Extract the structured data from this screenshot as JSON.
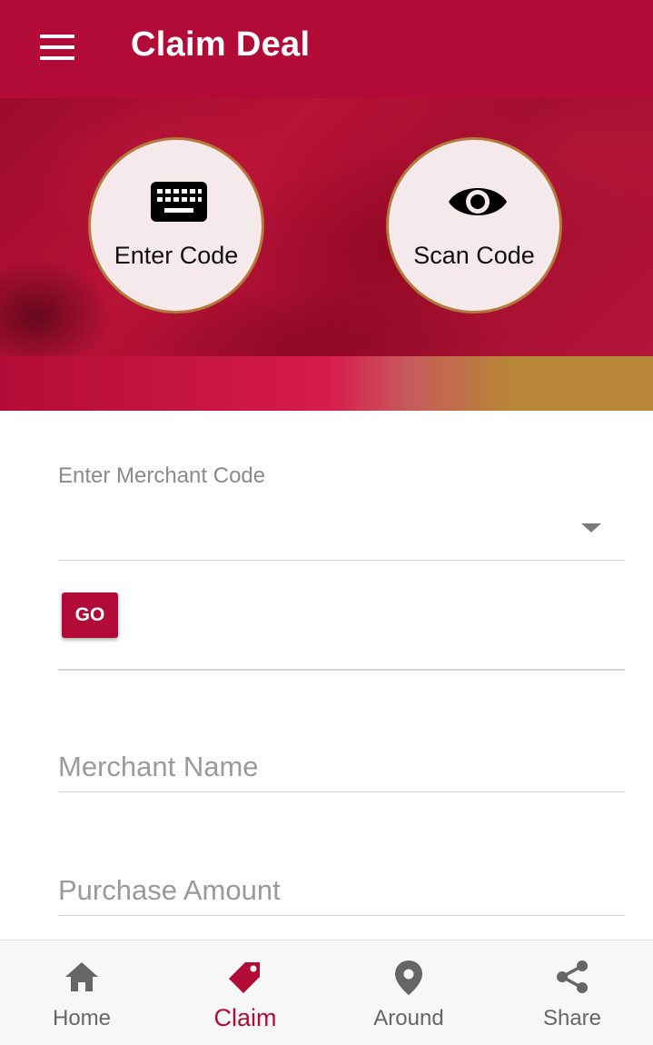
{
  "app_bar": {
    "title": "Claim Deal",
    "menu_icon": "menu-icon",
    "background_color": "#b30b37"
  },
  "hero": {
    "actions": [
      {
        "label": "Enter Code",
        "icon": "keyboard-icon"
      },
      {
        "label": "Scan Code",
        "icon": "eye-icon"
      }
    ]
  },
  "form": {
    "merchant_code_label": "Enter Merchant Code",
    "merchant_code_value": "",
    "go_label": "GO",
    "merchant_name_placeholder": "Merchant Name",
    "merchant_name_value": "",
    "purchase_amount_placeholder": "Purchase Amount",
    "purchase_amount_value": ""
  },
  "bottom_nav": {
    "items": [
      {
        "label": "Home",
        "icon": "home-icon",
        "active": false
      },
      {
        "label": "Claim",
        "icon": "tag-icon",
        "active": true
      },
      {
        "label": "Around",
        "icon": "location-pin-icon",
        "active": false
      },
      {
        "label": "Share",
        "icon": "share-icon",
        "active": false
      }
    ],
    "active_color": "#b30b37",
    "inactive_color": "#666666"
  }
}
